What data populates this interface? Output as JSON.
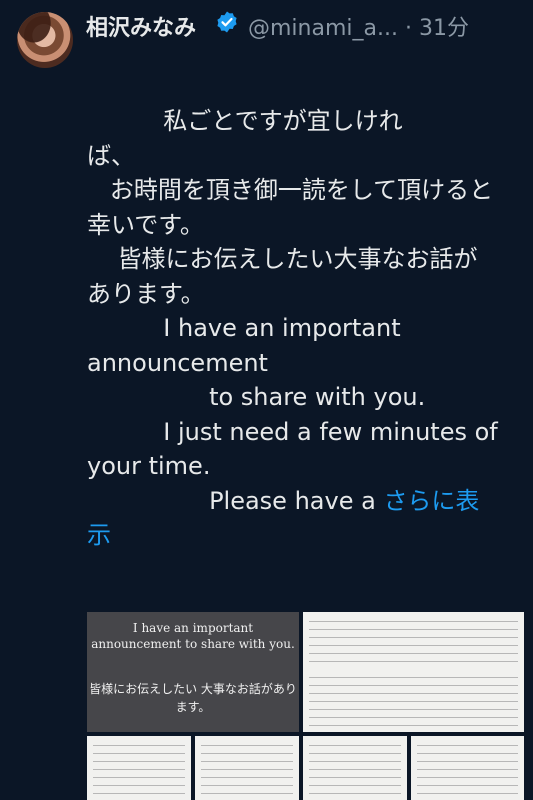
{
  "header": {
    "display_name": "相沢みなみ",
    "handle_time": "@minami_a... · 31分",
    "verified_icon": "verified-badge-icon"
  },
  "post": {
    "lines": [
      "          私ごとですが宜しけれ",
      "ば、",
      "   お時間を頂き御一読をして頂けると",
      "幸いです。",
      "    皆様にお伝えしたい大事なお話が",
      "あります。",
      "",
      "          I have an important",
      "announcement",
      "                to share with you.",
      "          I just need a few minutes of",
      "your time.",
      "                Please have a "
    ],
    "show_more_1": "さらに表",
    "show_more_2": "示"
  },
  "media": {
    "image1_en": "I have an important announcement to share with you.",
    "image1_ja": "皆様にお伝えしたい 大事なお話があります。"
  },
  "colors": {
    "background": "#0b1626",
    "text": "#e7e9ea",
    "secondary": "#8b98a5",
    "link": "#1d9bf0"
  }
}
